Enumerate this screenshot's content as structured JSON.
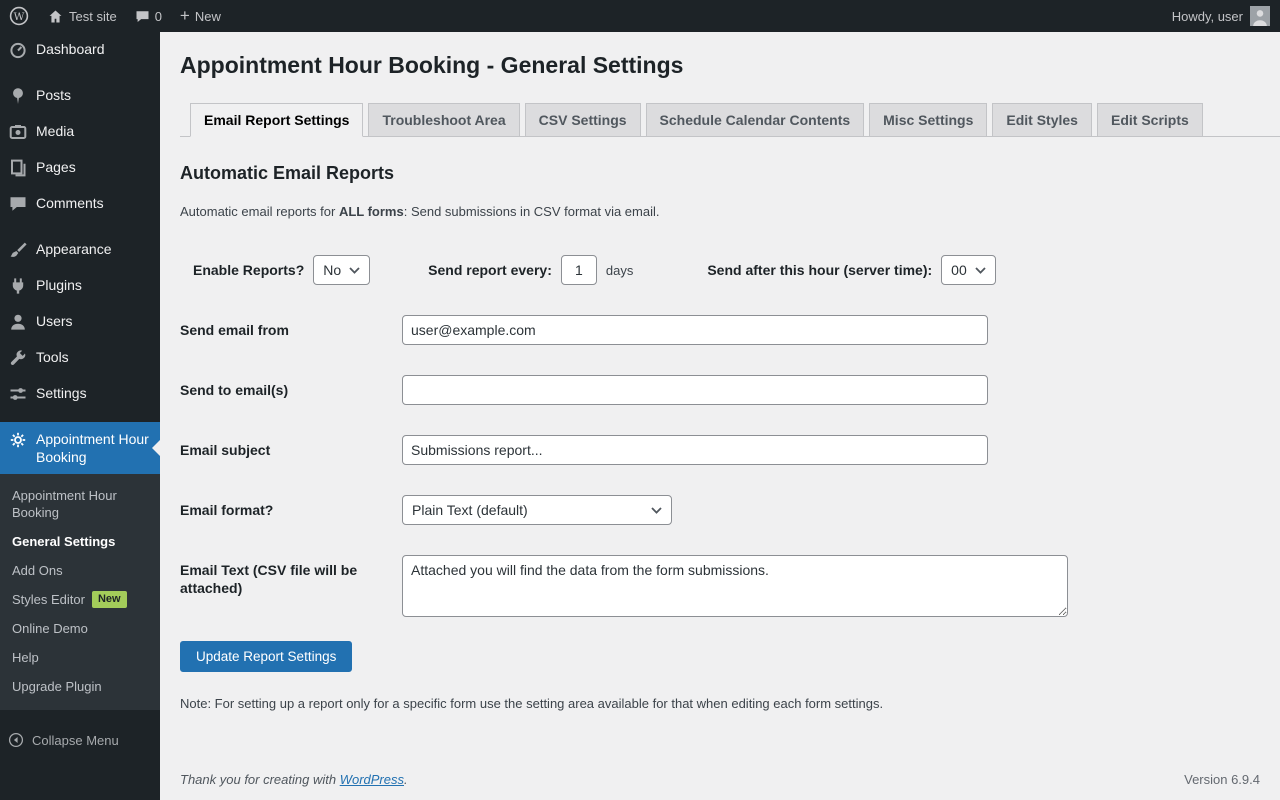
{
  "admin_bar": {
    "site_name": "Test site",
    "comments_count": "0",
    "new_label": "New",
    "howdy": "Howdy, user"
  },
  "sidebar": {
    "items": [
      {
        "label": "Dashboard",
        "icon": "dashboard-icon"
      },
      {
        "label": "Posts",
        "icon": "pin-icon"
      },
      {
        "label": "Media",
        "icon": "camera-icon"
      },
      {
        "label": "Pages",
        "icon": "pages-icon"
      },
      {
        "label": "Comments",
        "icon": "comment-icon"
      },
      {
        "label": "Appearance",
        "icon": "brush-icon"
      },
      {
        "label": "Plugins",
        "icon": "plugin-icon"
      },
      {
        "label": "Users",
        "icon": "user-icon"
      },
      {
        "label": "Tools",
        "icon": "tools-icon"
      },
      {
        "label": "Settings",
        "icon": "sliders-icon"
      }
    ],
    "active_item": {
      "label": "Appointment Hour Booking",
      "icon": "gear-icon"
    },
    "submenu": [
      {
        "label": "Appointment Hour Booking"
      },
      {
        "label": "General Settings",
        "current": true
      },
      {
        "label": "Add Ons"
      },
      {
        "label": "Styles Editor",
        "badge": "New"
      },
      {
        "label": "Online Demo"
      },
      {
        "label": "Help"
      },
      {
        "label": "Upgrade Plugin"
      }
    ],
    "collapse_label": "Collapse Menu"
  },
  "main": {
    "title": "Appointment Hour Booking - General Settings",
    "tabs": [
      "Email Report Settings",
      "Troubleshoot Area",
      "CSV Settings",
      "Schedule Calendar Contents",
      "Misc Settings",
      "Edit Styles",
      "Edit Scripts"
    ],
    "active_tab": "Email Report Settings",
    "section_title": "Automatic Email Reports",
    "intro_prefix": "Automatic email reports for ",
    "intro_bold": "ALL forms",
    "intro_suffix": ": Send submissions in CSV format via email.",
    "form": {
      "enable_reports_label": "Enable Reports?",
      "enable_reports_value": "No",
      "send_every_label": "Send report every:",
      "send_every_value": "1",
      "send_every_unit": "days",
      "send_hour_label": "Send after this hour (server time):",
      "send_hour_value": "00",
      "from_label": "Send email from",
      "from_value": "user@example.com",
      "to_label": "Send to email(s)",
      "to_value": "",
      "subject_label": "Email subject",
      "subject_value": "Submissions report...",
      "format_label": "Email format?",
      "format_value": "Plain Text (default)",
      "text_label": "Email Text (CSV file will be attached)",
      "text_value": "Attached you will find the data from the form submissions.",
      "submit_label": "Update Report Settings"
    },
    "note": "Note: For setting up a report only for a specific form use the setting area available for that when editing each form settings."
  },
  "footer": {
    "thanks_prefix": "Thank you for creating with ",
    "wordpress_link": "WordPress",
    "thanks_suffix": ".",
    "version": "Version 6.9.4"
  },
  "colors": {
    "accent": "#2271b1",
    "admin_bar_bg": "#1d2327",
    "sidebar_bg": "#1d2327",
    "submenu_bg": "#2c3338",
    "content_bg": "#f0f0f1",
    "new_badge_bg": "#a3cc5a",
    "input_border": "#8c8f94"
  }
}
